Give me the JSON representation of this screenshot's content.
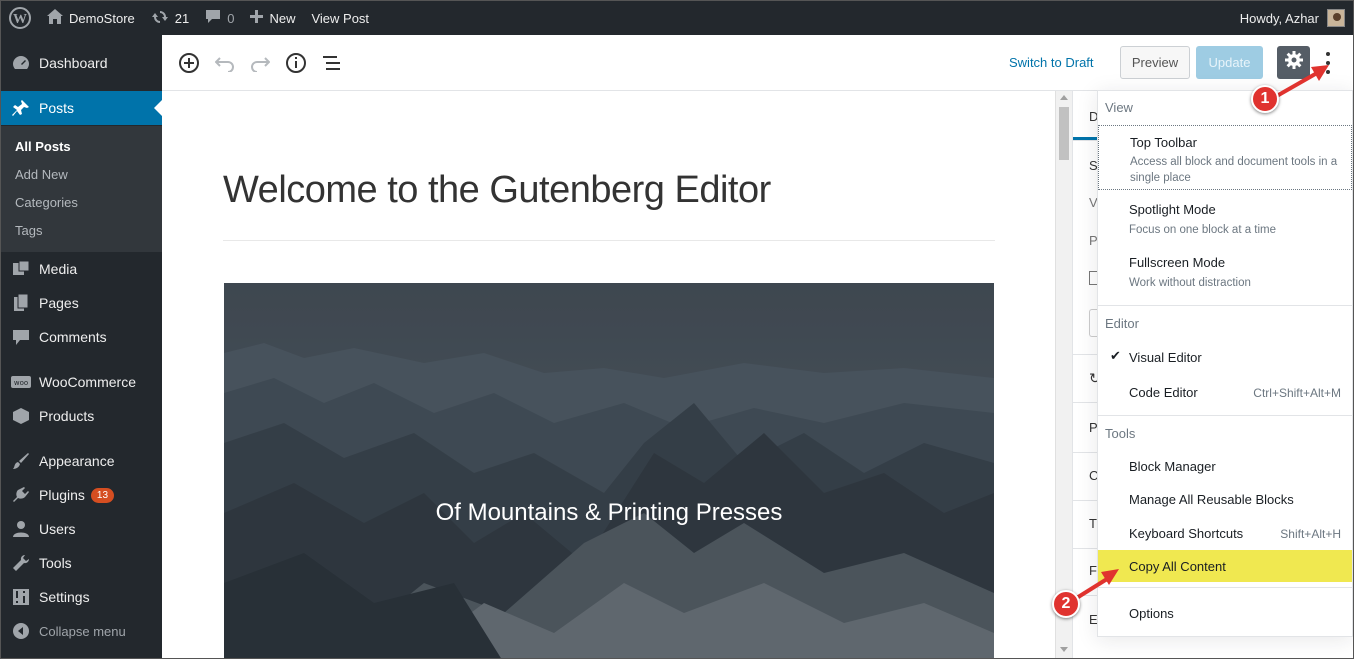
{
  "admin_bar": {
    "site_name": "DemoStore",
    "updates_count": "21",
    "comments_count": "0",
    "new_label": "New",
    "view_post_label": "View Post",
    "howdy": "Howdy, Azhar"
  },
  "sidebar": {
    "items": [
      {
        "label": "Dashboard",
        "icon": "dashboard-icon"
      },
      {
        "label": "Posts",
        "icon": "pin-icon",
        "active": true
      },
      {
        "label": "Media",
        "icon": "media-icon"
      },
      {
        "label": "Pages",
        "icon": "pages-icon"
      },
      {
        "label": "Comments",
        "icon": "comment-icon"
      },
      {
        "label": "WooCommerce",
        "icon": "woocommerce-icon"
      },
      {
        "label": "Products",
        "icon": "products-icon"
      },
      {
        "label": "Appearance",
        "icon": "brush-icon"
      },
      {
        "label": "Plugins",
        "icon": "plugin-icon",
        "badge": "13"
      },
      {
        "label": "Users",
        "icon": "users-icon"
      },
      {
        "label": "Tools",
        "icon": "wrench-icon"
      },
      {
        "label": "Settings",
        "icon": "settings-icon"
      }
    ],
    "submenu": [
      "All Posts",
      "Add New",
      "Categories",
      "Tags"
    ],
    "collapse_label": "Collapse menu"
  },
  "header": {
    "switch_to_draft": "Switch to Draft",
    "preview": "Preview",
    "update": "Update"
  },
  "post": {
    "title": "Welcome to the Gutenberg Editor",
    "cover_text": "Of Mountains & Printing Presses"
  },
  "settings_panel": {
    "letters": [
      "D",
      "S",
      "V",
      "P",
      "P",
      "C",
      "T",
      "F",
      "E"
    ]
  },
  "dropdown": {
    "view_label": "View",
    "top_toolbar": {
      "title": "Top Toolbar",
      "desc": "Access all block and document tools in a single place"
    },
    "spotlight": {
      "title": "Spotlight Mode",
      "desc": "Focus on one block at a time"
    },
    "fullscreen": {
      "title": "Fullscreen Mode",
      "desc": "Work without distraction"
    },
    "editor_label": "Editor",
    "visual_editor": "Visual Editor",
    "code_editor": "Code Editor",
    "code_editor_shortcut": "Ctrl+Shift+Alt+M",
    "tools_label": "Tools",
    "block_manager": "Block Manager",
    "reusable_blocks": "Manage All Reusable Blocks",
    "keyboard_shortcuts": "Keyboard Shortcuts",
    "keyboard_shortcut_keys": "Shift+Alt+H",
    "copy_all": "Copy All Content",
    "options": "Options"
  },
  "callouts": [
    "1",
    "2"
  ],
  "colors": {
    "admin_dark": "#23282d",
    "accent_blue": "#0073aa",
    "highlight_yellow": "#f0e850",
    "callout_red": "#e0332f"
  }
}
